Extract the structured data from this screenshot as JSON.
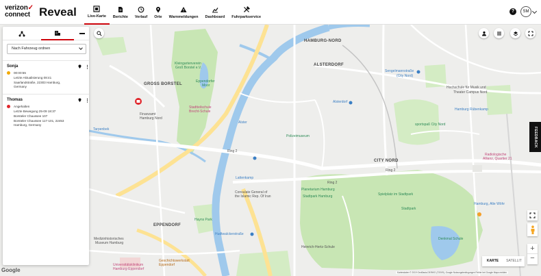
{
  "header": {
    "brand_top": "verizon",
    "brand_bottom": "connect",
    "product": "Reveal",
    "help": "?",
    "user_initials": "SM"
  },
  "nav": [
    {
      "label": "Live-Karte",
      "icon": "live-map-icon",
      "active": true
    },
    {
      "label": "Berichte",
      "icon": "report-icon",
      "active": false
    },
    {
      "label": "Verlauf",
      "icon": "history-icon",
      "active": false
    },
    {
      "label": "Orte",
      "icon": "places-pin-icon",
      "active": false
    },
    {
      "label": "Warnmeldungen",
      "icon": "alert-icon",
      "active": false
    },
    {
      "label": "Dashboard",
      "icon": "dashboard-icon",
      "active": false
    },
    {
      "label": "Fuhrparkservice",
      "icon": "fleet-service-icon",
      "active": false
    }
  ],
  "panel": {
    "sort_value": "Nach Fahrzeug ordnen",
    "vehicles": [
      {
        "name": "Sonja",
        "status_color": "#f2a900",
        "lines": [
          "00:00:55",
          "Letzte Aktualisierung 08:41",
          "Saarlandstraße, 22303 Hamburg,",
          "Germany"
        ]
      },
      {
        "name": "Thomas",
        "status_color": "#e0262b",
        "lines": [
          "Angehalten",
          "Letzte Bewegung 25-09 18:37",
          "Borsteler Chaussee 107",
          "Borsteler Chaussee 117-101, 22453",
          "Hamburg, Germany"
        ]
      }
    ]
  },
  "map": {
    "labels": [
      {
        "text": "HAMBURG-NORD",
        "cls": "dark"
      },
      {
        "text": "ALSTERDORF",
        "cls": "dark"
      },
      {
        "text": "GROSS BORSTEL",
        "cls": "dark"
      },
      {
        "text": "CITY NORD",
        "cls": "dark"
      },
      {
        "text": "EPPENDORF",
        "cls": "dark"
      },
      {
        "text": "Sengelmannstraße",
        "cls": "blue"
      },
      {
        "text": "(City Nord)",
        "cls": "blue"
      },
      {
        "text": "Alsterdorf",
        "cls": "blue"
      },
      {
        "text": "Lattenkamp",
        "cls": "blue"
      },
      {
        "text": "Hudtwalckerstraße",
        "cls": "blue"
      },
      {
        "text": "Hamburg Rübenkamp",
        "cls": "blue"
      },
      {
        "text": "Hamburg, Alte Wöhr",
        "cls": "blue"
      },
      {
        "text": "Kleingartenverein",
        "cls": "green"
      },
      {
        "text": "Groß Borstel e.V.",
        "cls": "green"
      },
      {
        "text": "Eppendorfer",
        "cls": "green"
      },
      {
        "text": "Moor",
        "cls": "green"
      },
      {
        "text": "sportspaß City Nord",
        "cls": "green"
      },
      {
        "text": "Stadtpark Hamburg",
        "cls": "green"
      },
      {
        "text": "Spielplatz im Stadtpark",
        "cls": "green"
      },
      {
        "text": "Stadtpark",
        "cls": "green"
      },
      {
        "text": "Hayns Park",
        "cls": "green"
      },
      {
        "text": "Polizeimuseum",
        "cls": "green"
      },
      {
        "text": "Planetarium Hamburg",
        "cls": "green"
      },
      {
        "text": "Stadtteilschule",
        "cls": "pink"
      },
      {
        "text": "Brecht-Schule",
        "cls": "pink"
      },
      {
        "text": "Hochschule für Musik und",
        "cls": ""
      },
      {
        "text": "Theater Campus Nord",
        "cls": ""
      },
      {
        "text": "Finanzamt",
        "cls": ""
      },
      {
        "text": "Hamburg Nord",
        "cls": ""
      },
      {
        "text": "Consulate General of",
        "cls": ""
      },
      {
        "text": "the Islamic Rep. Of Iran",
        "cls": ""
      },
      {
        "text": "Radiologische",
        "cls": "pink"
      },
      {
        "text": "Allianz, Quartier 21",
        "cls": "pink"
      },
      {
        "text": "Universitätsklinikum",
        "cls": "pink"
      },
      {
        "text": "Hamburg-Eppendorf",
        "cls": "pink"
      },
      {
        "text": "Medizinhistorisches",
        "cls": ""
      },
      {
        "text": "Museum Hamburg",
        "cls": ""
      },
      {
        "text": "Geschichtswerkstatt",
        "cls": "orange"
      },
      {
        "text": "Eppendorf",
        "cls": "orange"
      },
      {
        "text": "Heinrich-Hertz-Schule",
        "cls": ""
      },
      {
        "text": "Denkmal Schule",
        "cls": "green"
      },
      {
        "text": "Tarpenbek",
        "cls": "blue"
      },
      {
        "text": "Alster",
        "cls": "blue"
      },
      {
        "text": "Ring 2",
        "cls": ""
      },
      {
        "text": "Ring 2",
        "cls": ""
      },
      {
        "text": "Ring 2",
        "cls": ""
      }
    ],
    "map_type_active": "KARTE",
    "map_type_other": "SATELLIT",
    "feedback": "FEEDBACK",
    "google": "Google",
    "attribution": "Kartendaten © 2019 GeoBasis-DE/BKG (©2009), Google   Nutzungsbedingungen   Fehler bei Google Maps melden"
  }
}
